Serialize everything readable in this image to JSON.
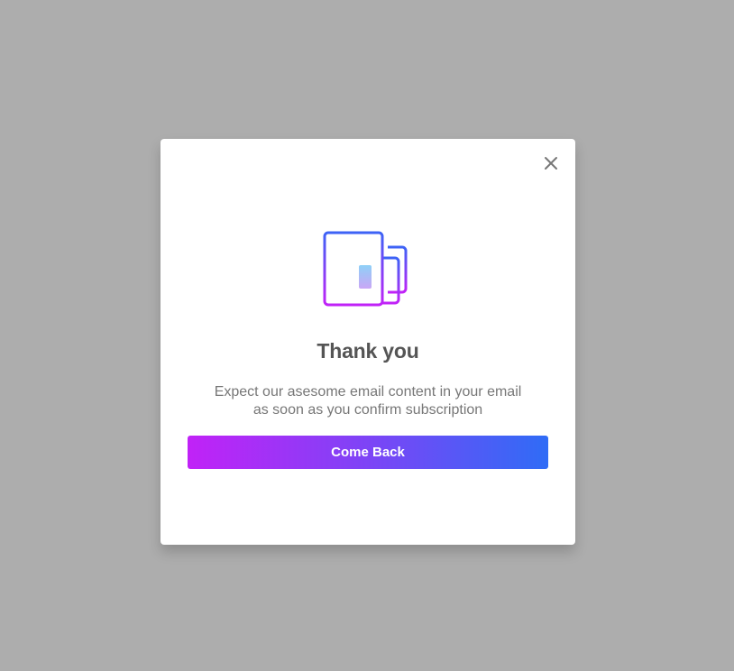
{
  "modal": {
    "close_icon": "close-icon",
    "illustration_icon": "newspaper-icon",
    "title": "Thank you",
    "message_line1": "Expect our asesome email content in your email",
    "message_line2": "as soon as you confirm subscription",
    "button_label": "Come Back"
  },
  "colors": {
    "backdrop": "#adadad",
    "title": "#555555",
    "message": "#777777",
    "gradient_start": "#c122f7",
    "gradient_end": "#2f6cf6"
  }
}
